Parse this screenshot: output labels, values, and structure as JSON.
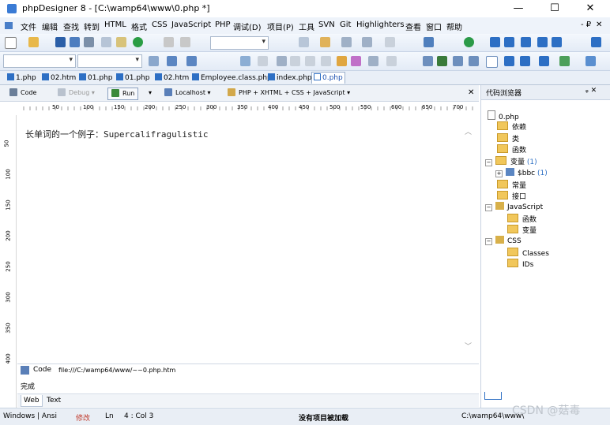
{
  "window": {
    "title": "phpDesigner 8 - [C:\\wamp64\\www\\0.php *]",
    "minimize": "—",
    "maximize": "☐",
    "close": "✕"
  },
  "menu": [
    "文件",
    "编辑",
    "查找",
    "转到",
    "HTML",
    "格式",
    "CSS",
    "JavaScript",
    "PHP",
    "调试(D)",
    "项目(P)",
    "工具",
    "SVN",
    "Git",
    "Highlighters",
    "查看",
    "窗口",
    "帮助"
  ],
  "menu_right": {
    "restore": "- ₽",
    "close": "✕"
  },
  "tabs": [
    "1.php",
    "02.htm",
    "01.php",
    "01.php",
    "02.htm",
    "Employee.class.php",
    "index.php",
    "0.php"
  ],
  "active_tab": "0.php",
  "editor_toolbar": {
    "code": "Code",
    "debug": "Debug",
    "run": "Run",
    "localhost": "Localhost",
    "mode": "PHP + XHTML + CSS + JavaScript",
    "close": "✕"
  },
  "ruler": {
    "h_labels": [
      "50",
      "100",
      "150",
      "200",
      "250",
      "300",
      "350",
      "400",
      "450",
      "500",
      "550",
      "600",
      "650",
      "700"
    ],
    "v_labels": [
      "50",
      "100",
      "150",
      "200",
      "250",
      "300",
      "350",
      "400"
    ]
  },
  "code_text": "长单词的一个例子：Supercalifragulistic",
  "output": {
    "code_tab": "Code",
    "url": "file:///C:/wamp64/www/~~0.php.htm",
    "result": "完成",
    "tab_web": "Web",
    "tab_text": "Text"
  },
  "code_browser": {
    "title": "代码浏览器",
    "pin": "ᵩ ✕",
    "file": "0.php",
    "php_nodes": [
      "依赖",
      "类",
      "函数",
      "变量",
      "常量",
      "接口"
    ],
    "var_count": "(1)",
    "var_child": "$bbc",
    "var_child_count": "(1)",
    "js_label": "JavaScript",
    "js_nodes": [
      "函数",
      "变量"
    ],
    "css_label": "CSS",
    "css_nodes": [
      "Classes",
      "IDs"
    ]
  },
  "status": {
    "mode": "Windows | Ansi",
    "modified": "修改",
    "ln_label": "Ln",
    "pos": "4 : Col 3",
    "project": "没有项目被加载",
    "path": "C:\\wamp64\\www\\",
    "watermark": "CSDN @菇毒"
  },
  "colors": {
    "accent": "#2d6fc4",
    "modified": "#c0392b",
    "folder": "#f1c75b"
  }
}
